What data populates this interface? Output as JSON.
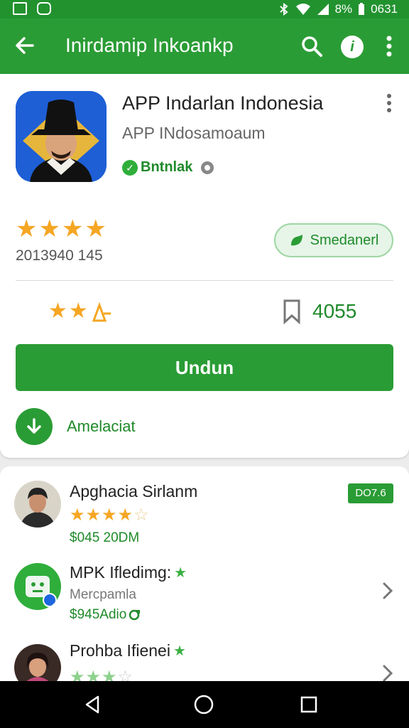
{
  "status_bar": {
    "battery": "8%",
    "time": "0631"
  },
  "app_bar": {
    "title": "Inirdamip Inkoankp",
    "icons": [
      "back-arrow-icon",
      "search-icon",
      "help-icon",
      "more-vert-icon"
    ]
  },
  "app": {
    "title": "APP Indarlan Indonesia",
    "developer": "APP INdosamoaum",
    "verified_label": "Bntnlak",
    "rating_stars": 4,
    "rating_count": "2013940 145",
    "pill_label": "Smedanerl",
    "mini_rating_stars": 2,
    "downloads": "4055",
    "install_label": "Undun",
    "download_label": "Amelaciat"
  },
  "list": [
    {
      "title": "Apghacia Sirlanm",
      "stars": 3.5,
      "price": "$045 20DM",
      "badge": "DO7.6"
    },
    {
      "title": "MPK Ifledimg:",
      "subtitle": "Mercpamla",
      "price": "$945Adio",
      "price_icon": "refresh-icon"
    },
    {
      "title": "Prohba Ifienei",
      "stars": 3
    }
  ],
  "colors": {
    "primary": "#2a9c35",
    "star": "#f5a623",
    "text_green": "#1f8a2a"
  }
}
